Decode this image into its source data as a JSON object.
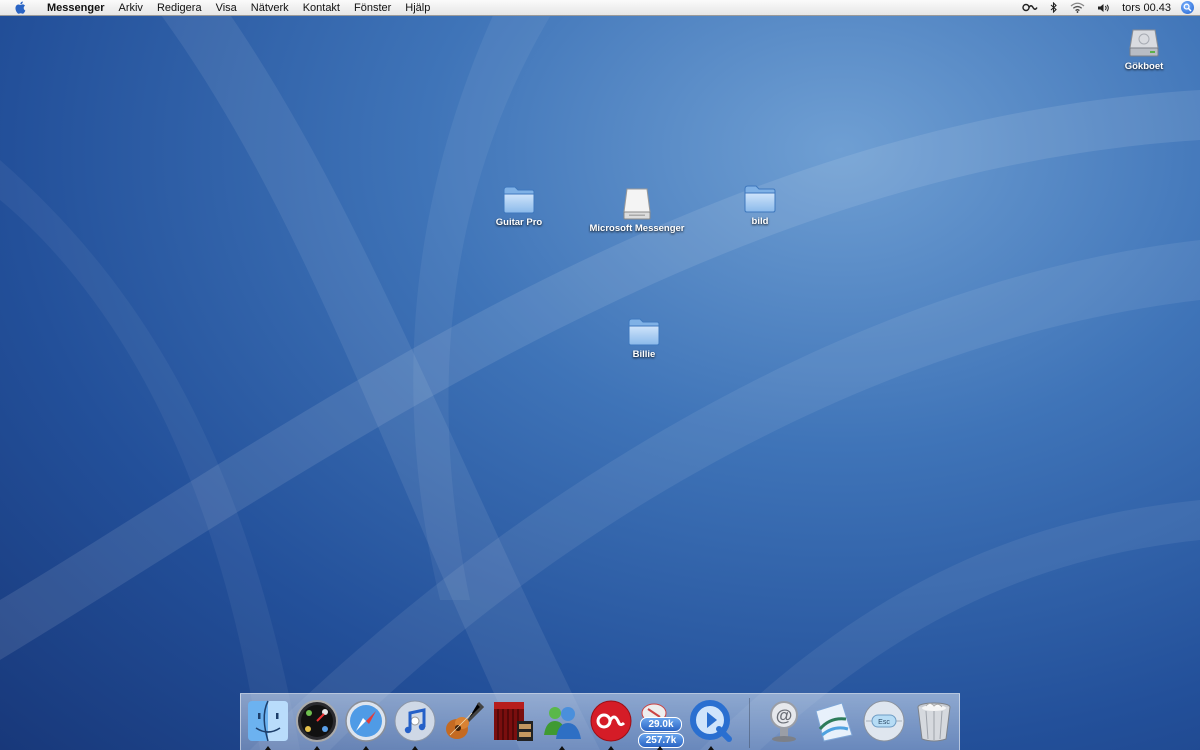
{
  "menubar": {
    "apple_icon": "apple-icon",
    "app_name": "Messenger",
    "menus": [
      "Arkiv",
      "Redigera",
      "Visa",
      "Nätverk",
      "Kontakt",
      "Fönster",
      "Hjälp"
    ],
    "extras": {
      "lastfm_icon": "lastfm-menu-icon",
      "bluetooth_icon": "bluetooth-icon",
      "wifi_icon": "wifi-icon",
      "volume_icon": "volume-icon",
      "clock": "tors 00.43",
      "spotlight_icon": "spotlight-icon"
    }
  },
  "desktop": {
    "icons": [
      {
        "label": "Gökboet",
        "type": "hard-drive"
      },
      {
        "label": "Guitar Pro",
        "type": "folder"
      },
      {
        "label": "Microsoft Messenger",
        "type": "disk-image"
      },
      {
        "label": "bild",
        "type": "folder"
      },
      {
        "label": "Billie",
        "type": "folder"
      }
    ]
  },
  "dock": {
    "apps": [
      {
        "name": "Finder",
        "icon": "finder-icon",
        "running": true
      },
      {
        "name": "Dashboard",
        "icon": "dashboard-icon",
        "running": true
      },
      {
        "name": "Safari",
        "icon": "safari-icon",
        "running": true
      },
      {
        "name": "iTunes",
        "icon": "itunes-icon",
        "running": true
      },
      {
        "name": "GarageBand",
        "icon": "garageband-icon",
        "running": false
      },
      {
        "name": "Front Row",
        "icon": "front-row-icon",
        "running": false
      },
      {
        "name": "Messenger",
        "icon": "messenger-icon",
        "running": true
      },
      {
        "name": "Last.fm",
        "icon": "lastfm-icon",
        "running": true
      },
      {
        "name": "Network Monitor",
        "icon": "network-monitor-icon",
        "running": true,
        "upload": "29.0k",
        "download": "257.7k"
      },
      {
        "name": "QuickTime Player",
        "icon": "quicktime-icon",
        "running": true
      }
    ],
    "others": [
      {
        "name": "Mail",
        "icon": "mail-stamp-icon"
      },
      {
        "name": "Documents",
        "icon": "documents-icon"
      },
      {
        "name": "Front Row Remote",
        "icon": "remote-esc-icon",
        "esc_label": "Esc"
      },
      {
        "name": "Trash",
        "icon": "trash-icon"
      }
    ]
  },
  "colors": {
    "wallpaper_light": "#6f9fd3",
    "wallpaper_dark": "#18387a",
    "menubar": "#efefef",
    "accent": "#2a64c4"
  }
}
